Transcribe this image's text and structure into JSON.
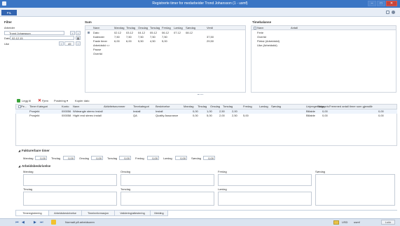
{
  "window": {
    "title": "Registrerte timer for medarbeider Trond Johansson (1 - usmf)"
  },
  "ribbon": {
    "file_tab": "FIL"
  },
  "filter": {
    "title": "Filter",
    "employee_label": "Arbeider",
    "employee_value": "Trond Johansson",
    "date_label": "Dato",
    "date_value": "02.12.15",
    "site_label": "Uke",
    "week_value": "49"
  },
  "sum": {
    "title": "Sum",
    "columns": [
      "Navn",
      "Mandag",
      "Tirsdag",
      "Onsdag",
      "Torsdag",
      "Fredag",
      "Lørdag",
      "Søndag",
      "Verdi"
    ],
    "rows": [
      [
        "Dato",
        "02.12",
        "03.12",
        "04.12",
        "05.12",
        "06.12",
        "07.12",
        "08.12",
        ""
      ],
      [
        "Kalender",
        "7,50",
        "7,50",
        "7,50",
        "7,50",
        "7,50",
        "",
        "",
        "37,50"
      ],
      [
        "Faste timer",
        "6,00",
        "6,00",
        "5,50",
        "4,50",
        "5,00",
        "",
        "",
        "29,50"
      ],
      [
        "Arbeidstid <>",
        "",
        "",
        "",
        "",
        "",
        "",
        "",
        ""
      ],
      [
        "Pause",
        "",
        "",
        "",
        "",
        "",
        "",
        "",
        ""
      ],
      [
        "Overtid",
        "",
        "",
        "",
        "",
        "",
        "",
        "",
        ""
      ]
    ]
  },
  "time_balance": {
    "title": "Timebalanse",
    "columns": [
      "Navn",
      "Antall"
    ],
    "rows": [
      "Ferie",
      "Overtid",
      "Fleksi (Arbeidstid)",
      "Uke (Arbeidstid)"
    ]
  },
  "toolbar": {
    "add": "Legg til",
    "delete": "Fjern",
    "posting": "Postering ▾",
    "copy": "Kopier dato"
  },
  "lines": {
    "columns": [
      "Pe...",
      "Timer Kategori",
      "Konto",
      "Navn",
      "Aktivitetsnummer",
      "Timekategori",
      "Beskrivelse",
      "Mandag",
      "Tirsdag",
      "Onsdag",
      "Torsdag",
      "Fredag",
      "Lørdag",
      "Søndag",
      "Linjeegenskap",
      "Salgspris",
      "Fremmed antall timer som gjenstår"
    ],
    "rows": [
      [
        "Prosjekt",
        "000056",
        "Wideangle stereo install",
        "",
        "Install",
        "Install",
        "0,00",
        "1,00",
        "2,50",
        "2,00",
        "",
        "",
        "",
        "Billable",
        "0,00",
        "0,00"
      ],
      [
        "Prosjekt",
        "000058",
        "Hight end stereo install",
        "",
        "QA",
        "Quality Assurance",
        "0,00",
        "5,00",
        "2,00",
        "2,50",
        "5,00",
        "",
        "",
        "Billable",
        "0,00",
        "0,00"
      ]
    ]
  },
  "unbilled": {
    "title": "Fakturerbare timer",
    "days": [
      {
        "label": "Mandag",
        "value": "0,00"
      },
      {
        "label": "Tirsdag",
        "value": "0,00"
      },
      {
        "label": "Onsdag",
        "value": "0,00"
      },
      {
        "label": "Torsdag",
        "value": "0,00"
      },
      {
        "label": "Fredag",
        "value": "0,00"
      },
      {
        "label": "Lørdag",
        "value": "0,00"
      },
      {
        "label": "Søndag",
        "value": "0,00"
      }
    ]
  },
  "work_desc": {
    "title": "Arbeidsbeskrivelse",
    "fields": [
      "Mandag",
      "Onsdag",
      "Fredag",
      "Søndag",
      "Tirsdag",
      "Torsdag",
      "Lørdag"
    ]
  },
  "tabs": [
    "Timeregistrering",
    "Arbeidsbeskrivelse",
    "Timeinnformasjon",
    "Validering/attestering",
    "Melding"
  ],
  "status": {
    "message": "Normalt på arbeidsoren",
    "currency": "USD",
    "company": "usmf",
    "close": "Lukk"
  },
  "colors": {
    "title_bar": "#3a75c4",
    "file_tab": "#3264b0",
    "add_icon": "#3aa33a",
    "delete_icon": "#d02020"
  }
}
